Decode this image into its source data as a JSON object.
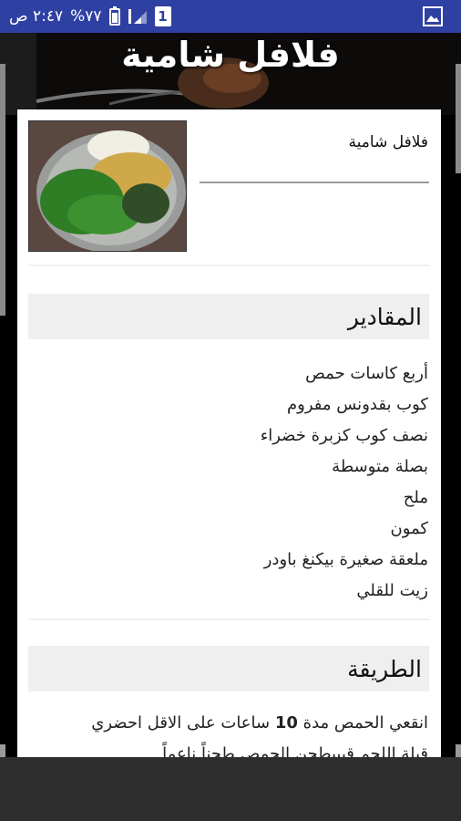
{
  "status_bar": {
    "time": "٢:٤٧ ص",
    "battery": "%٧٧",
    "sim_slot": "1",
    "notification_icon": "image-icon"
  },
  "header": {
    "title": "فلافل شامية"
  },
  "recipe": {
    "name": "فلافل شامية",
    "image_icon": "falafel-ingredients-photo"
  },
  "ingredients": {
    "heading": "المقادير",
    "items": [
      "أربع كاسات حمص",
      "كوب بقدونس مفروم",
      "نصف كوب كزبرة خضراء",
      "بصلة متوسطة",
      "ملح",
      "كمون",
      "ملعقة صغيرة بيكنغ باودر",
      "زيت للقلي"
    ]
  },
  "method": {
    "heading": "الطريقة",
    "text_before": "انقعي الحمص مدة",
    "hours": "10",
    "text_after": "ساعات على الاقل احضري",
    "line2": "قبلة اللحم قبيبطحن الحمص طحناً ناعماً"
  },
  "colors": {
    "status_bar": "#2f40a3",
    "nav_bar": "#2e2e2e",
    "section_bg": "#efefef"
  }
}
